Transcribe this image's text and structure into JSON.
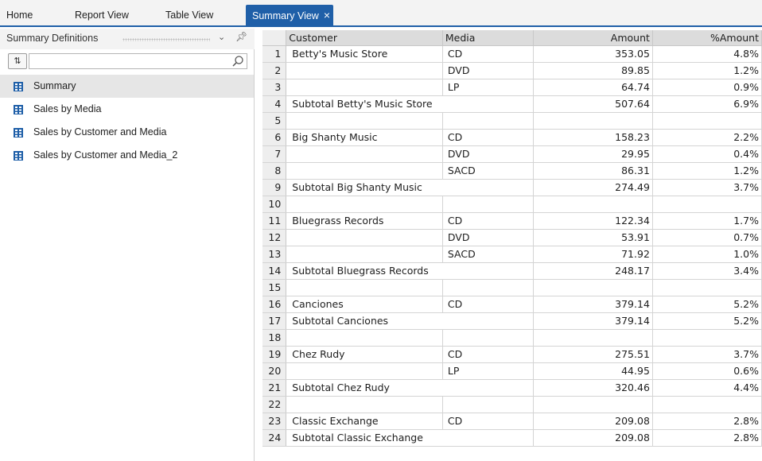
{
  "tabs": [
    {
      "label": "Home",
      "active": false
    },
    {
      "label": "Report View",
      "active": false
    },
    {
      "label": "Table View",
      "active": false
    },
    {
      "label": "Summary View",
      "active": true,
      "close": "×"
    }
  ],
  "left_panel": {
    "title": "Summary Definitions",
    "sort_button": "⇅",
    "search_placeholder": "",
    "items": [
      {
        "label": "Summary",
        "selected": true
      },
      {
        "label": "Sales by Media",
        "selected": false
      },
      {
        "label": "Sales by Customer and Media",
        "selected": false
      },
      {
        "label": "Sales by Customer and Media_2",
        "selected": false
      }
    ]
  },
  "table": {
    "headers": [
      "Customer",
      "Media",
      "Amount",
      "%Amount"
    ],
    "rows": [
      {
        "n": "1",
        "customer": "Betty's Music Store",
        "media": "CD",
        "amount": "353.05",
        "pct": "4.8%",
        "subtotal": false
      },
      {
        "n": "2",
        "customer": "",
        "media": "DVD",
        "amount": "89.85",
        "pct": "1.2%",
        "subtotal": false
      },
      {
        "n": "3",
        "customer": "",
        "media": "LP",
        "amount": "64.74",
        "pct": "0.9%",
        "subtotal": false
      },
      {
        "n": "4",
        "customer": "Subtotal Betty's Music Store",
        "media": "",
        "amount": "507.64",
        "pct": "6.9%",
        "subtotal": true
      },
      {
        "n": "5",
        "customer": "",
        "media": "",
        "amount": "",
        "pct": "",
        "subtotal": false
      },
      {
        "n": "6",
        "customer": "Big Shanty Music",
        "media": "CD",
        "amount": "158.23",
        "pct": "2.2%",
        "subtotal": false
      },
      {
        "n": "7",
        "customer": "",
        "media": "DVD",
        "amount": "29.95",
        "pct": "0.4%",
        "subtotal": false
      },
      {
        "n": "8",
        "customer": "",
        "media": "SACD",
        "amount": "86.31",
        "pct": "1.2%",
        "subtotal": false
      },
      {
        "n": "9",
        "customer": "Subtotal Big Shanty Music",
        "media": "",
        "amount": "274.49",
        "pct": "3.7%",
        "subtotal": true
      },
      {
        "n": "10",
        "customer": "",
        "media": "",
        "amount": "",
        "pct": "",
        "subtotal": false
      },
      {
        "n": "11",
        "customer": "Bluegrass Records",
        "media": "CD",
        "amount": "122.34",
        "pct": "1.7%",
        "subtotal": false
      },
      {
        "n": "12",
        "customer": "",
        "media": "DVD",
        "amount": "53.91",
        "pct": "0.7%",
        "subtotal": false
      },
      {
        "n": "13",
        "customer": "",
        "media": "SACD",
        "amount": "71.92",
        "pct": "1.0%",
        "subtotal": false
      },
      {
        "n": "14",
        "customer": "Subtotal Bluegrass Records",
        "media": "",
        "amount": "248.17",
        "pct": "3.4%",
        "subtotal": true
      },
      {
        "n": "15",
        "customer": "",
        "media": "",
        "amount": "",
        "pct": "",
        "subtotal": false
      },
      {
        "n": "16",
        "customer": "Canciones",
        "media": "CD",
        "amount": "379.14",
        "pct": "5.2%",
        "subtotal": false
      },
      {
        "n": "17",
        "customer": "Subtotal Canciones",
        "media": "",
        "amount": "379.14",
        "pct": "5.2%",
        "subtotal": true
      },
      {
        "n": "18",
        "customer": "",
        "media": "",
        "amount": "",
        "pct": "",
        "subtotal": false
      },
      {
        "n": "19",
        "customer": "Chez Rudy",
        "media": "CD",
        "amount": "275.51",
        "pct": "3.7%",
        "subtotal": false
      },
      {
        "n": "20",
        "customer": "",
        "media": "LP",
        "amount": "44.95",
        "pct": "0.6%",
        "subtotal": false
      },
      {
        "n": "21",
        "customer": "Subtotal Chez Rudy",
        "media": "",
        "amount": "320.46",
        "pct": "4.4%",
        "subtotal": true
      },
      {
        "n": "22",
        "customer": "",
        "media": "",
        "amount": "",
        "pct": "",
        "subtotal": false
      },
      {
        "n": "23",
        "customer": "Classic Exchange",
        "media": "CD",
        "amount": "209.08",
        "pct": "2.8%",
        "subtotal": false
      },
      {
        "n": "24",
        "customer": "Subtotal Classic Exchange",
        "media": "",
        "amount": "209.08",
        "pct": "2.8%",
        "subtotal": true
      }
    ]
  },
  "colors": {
    "accent": "#1f5fa8",
    "header_bg": "#dcdcdc",
    "selected_bg": "#e6e6e6"
  },
  "icons": {
    "tree_item": "table-icon",
    "search": "search-icon",
    "pin": "pin-icon",
    "dropdown": "chevron-down-icon"
  }
}
